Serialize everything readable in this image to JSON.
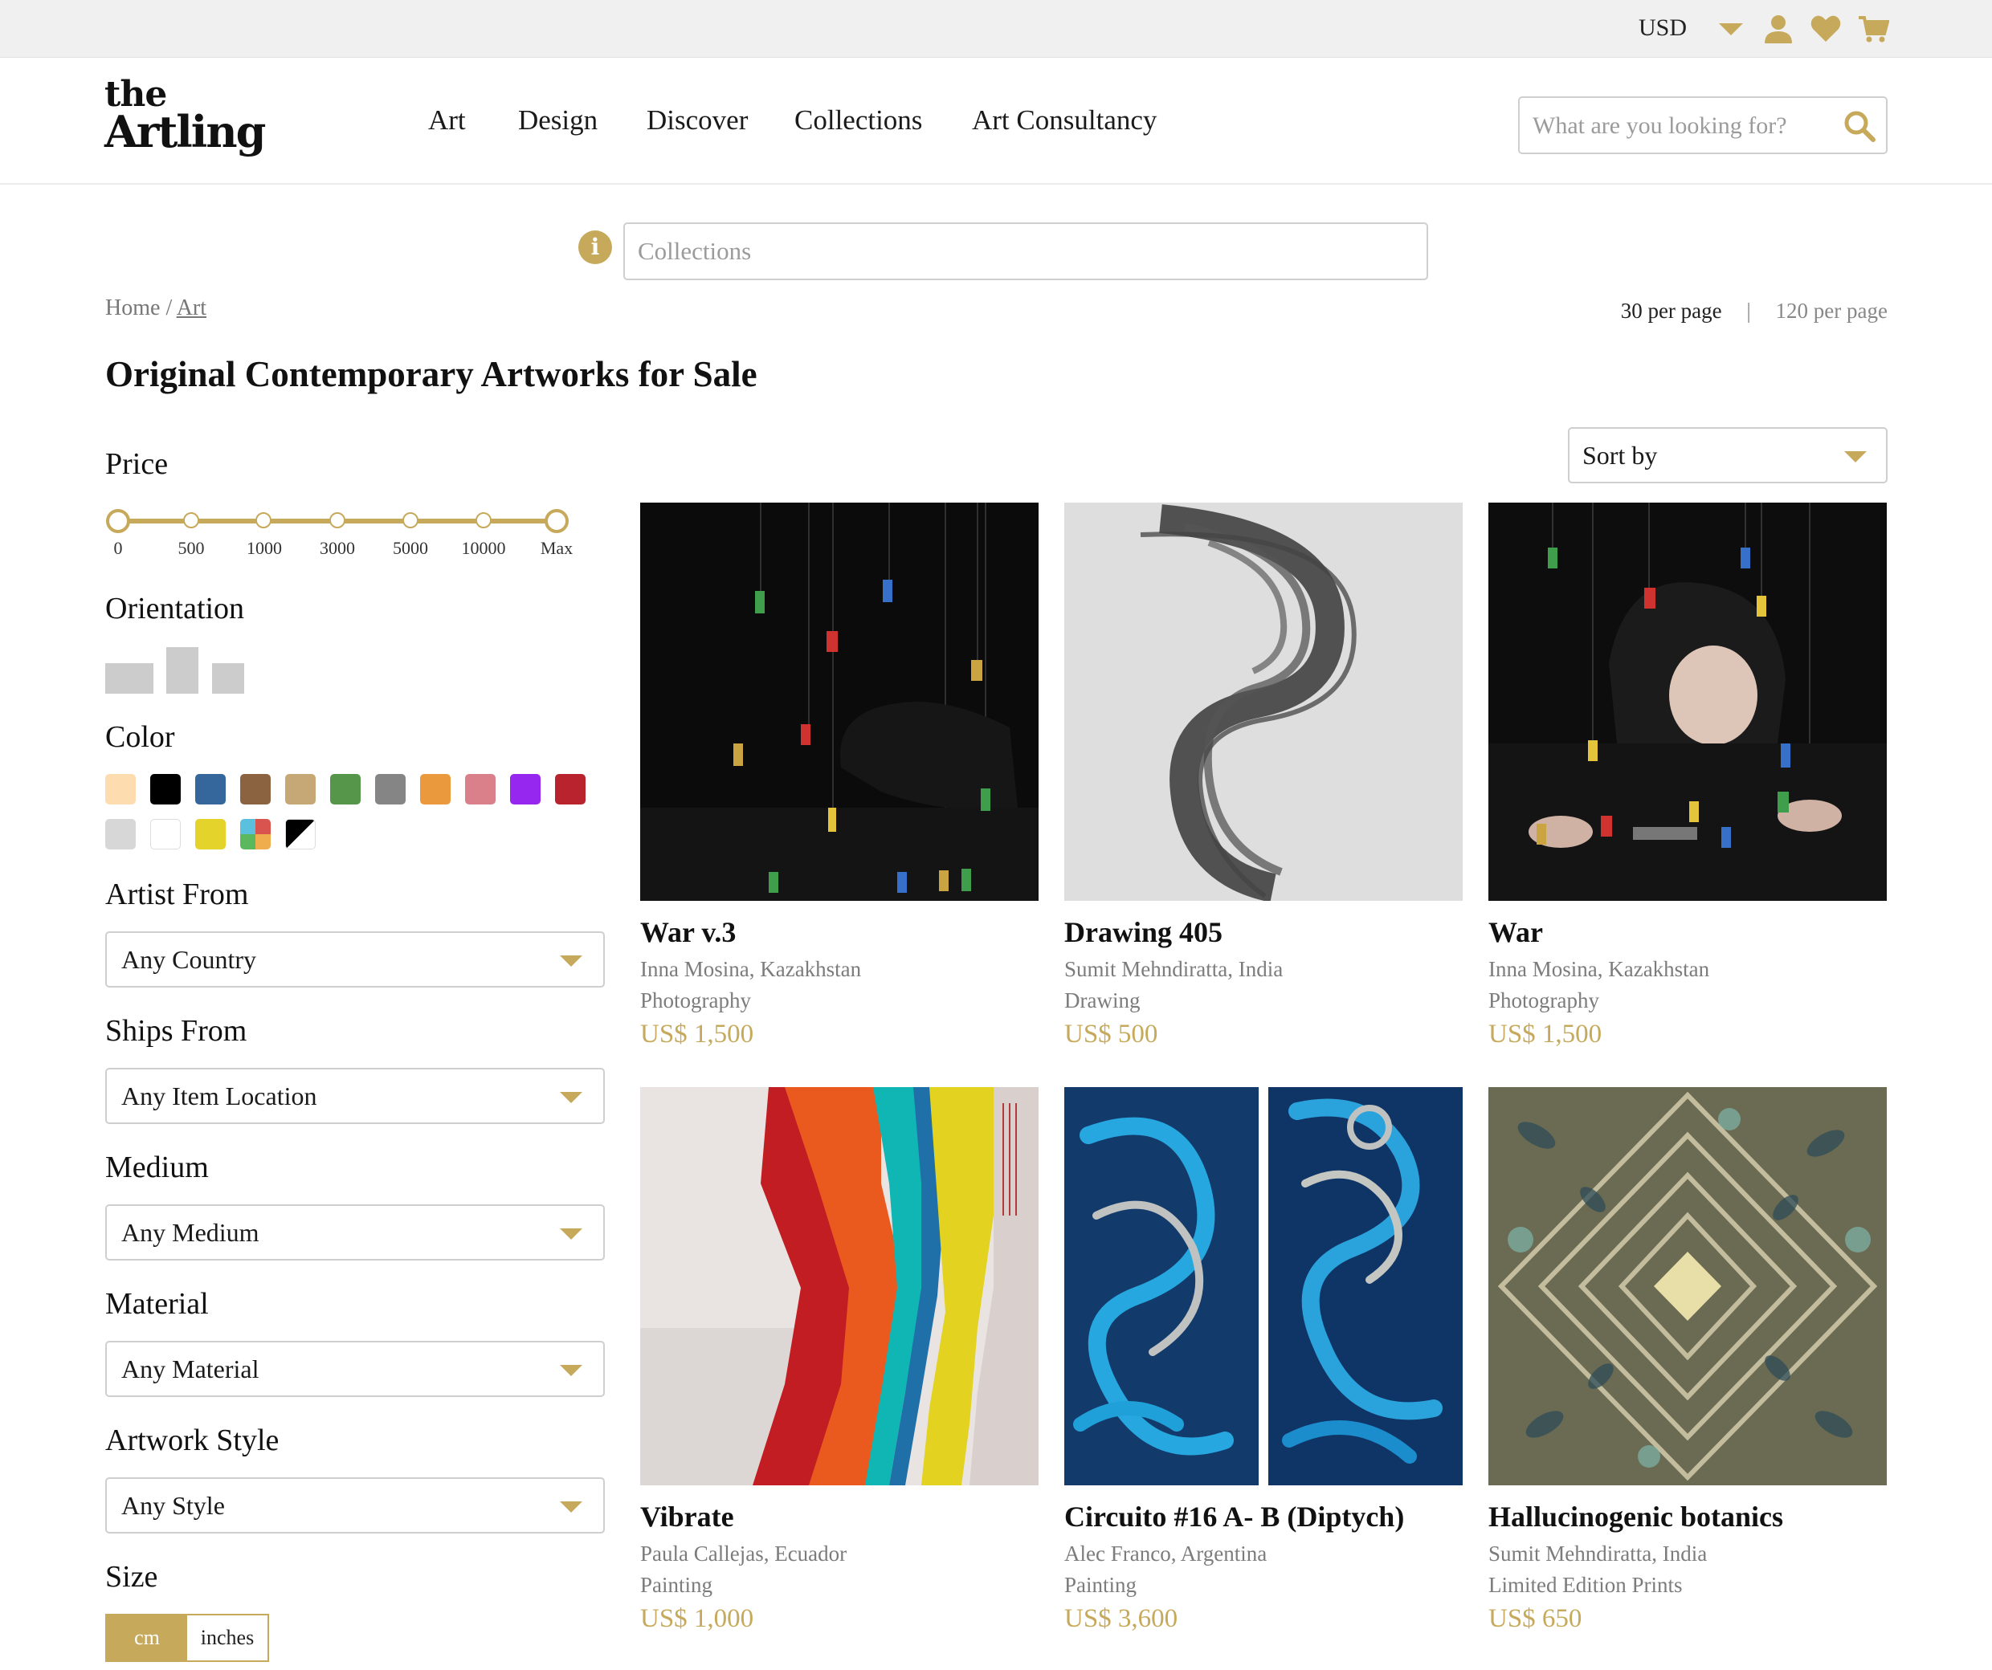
{
  "topbar": {
    "currency": "USD",
    "icons": [
      "chevron-down-icon",
      "user-icon",
      "heart-icon",
      "cart-icon"
    ]
  },
  "brand": {
    "logo_line1": "the",
    "logo_line2": "Artling"
  },
  "nav": [
    {
      "label": "Art"
    },
    {
      "label": "Design"
    },
    {
      "label": "Discover"
    },
    {
      "label": "Collections"
    },
    {
      "label": "Art Consultancy"
    }
  ],
  "search": {
    "placeholder": "What are you looking for?"
  },
  "collections_search": {
    "placeholder": "Collections",
    "info_glyph": "i"
  },
  "breadcrumb": {
    "home": "Home",
    "separator": "/",
    "current": "Art"
  },
  "per_page": {
    "active": "30 per page",
    "separator": "|",
    "other": "120 per page"
  },
  "page_title": "Original Contemporary Artworks for Sale",
  "filters": {
    "price": {
      "title": "Price",
      "ticks": [
        "0",
        "500",
        "1000",
        "3000",
        "5000",
        "10000",
        "Max"
      ]
    },
    "orientation": {
      "title": "Orientation"
    },
    "color": {
      "title": "Color",
      "swatches": [
        "#fddcb0",
        "#000000",
        "#35679c",
        "#8c6340",
        "#c6a877",
        "#56964a",
        "#858585",
        "#ea9a3c",
        "#d9808a",
        "#9627ee",
        "#b8232d",
        "#d7d7d7",
        "#ffffff",
        "#e3d32a",
        "multicolor",
        "black-white"
      ]
    },
    "artist_from": {
      "title": "Artist From",
      "value": "Any Country"
    },
    "ships_from": {
      "title": "Ships From",
      "value": "Any Item Location"
    },
    "medium": {
      "title": "Medium",
      "value": "Any Medium"
    },
    "material": {
      "title": "Material",
      "value": "Any Material"
    },
    "artwork_style": {
      "title": "Artwork Style",
      "value": "Any Style"
    },
    "size": {
      "title": "Size",
      "unit_cm": "cm",
      "unit_inches": "inches",
      "selected": "cm"
    }
  },
  "sort": {
    "label": "Sort by"
  },
  "products": [
    {
      "title": "War v.3",
      "artist": "Inna Mosina, Kazakhstan",
      "medium": "Photography",
      "price": "US$ 1,500"
    },
    {
      "title": "Drawing 405",
      "artist": "Sumit Mehndiratta, India",
      "medium": "Drawing",
      "price": "US$ 500"
    },
    {
      "title": "War",
      "artist": "Inna Mosina, Kazakhstan",
      "medium": "Photography",
      "price": "US$ 1,500"
    },
    {
      "title": "Vibrate",
      "artist": "Paula Callejas, Ecuador",
      "medium": "Painting",
      "price": "US$ 1,000"
    },
    {
      "title": "Circuito #16 A- B (Diptych)",
      "artist": "Alec Franco, Argentina",
      "medium": "Painting",
      "price": "US$ 3,600"
    },
    {
      "title": "Hallucinogenic botanics",
      "artist": "Sumit Mehndiratta, India",
      "medium": "Limited Edition Prints",
      "price": "US$ 650"
    }
  ],
  "colors": {
    "accent": "#c6a95a",
    "muted_text": "#7c7c7c",
    "topbar_bg": "#f0f0f0"
  }
}
